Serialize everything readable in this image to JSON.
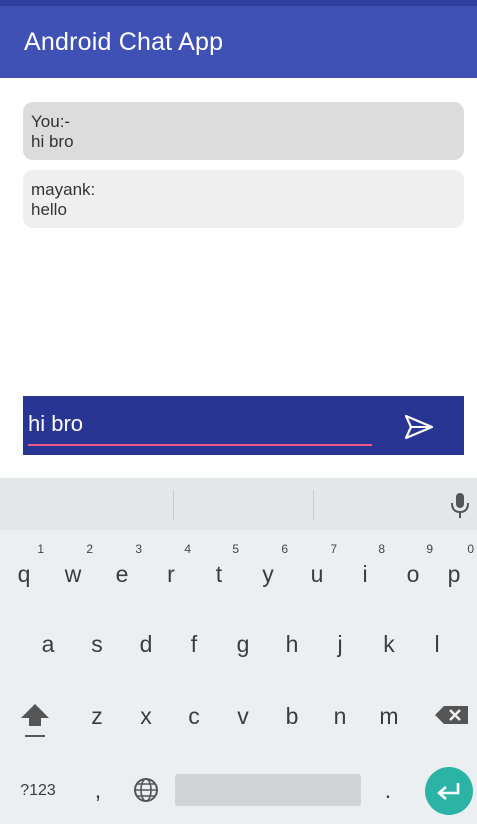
{
  "app": {
    "title": "Android Chat App"
  },
  "messages": [
    {
      "sender": "You:-",
      "text": "hi bro"
    },
    {
      "sender": "mayank:",
      "text": "hello"
    }
  ],
  "composer": {
    "value": "hi bro"
  },
  "keyboard": {
    "row1": [
      {
        "key": "q",
        "hint": "1"
      },
      {
        "key": "w",
        "hint": "2"
      },
      {
        "key": "e",
        "hint": "3"
      },
      {
        "key": "r",
        "hint": "4"
      },
      {
        "key": "t",
        "hint": "5"
      },
      {
        "key": "y",
        "hint": "6"
      },
      {
        "key": "u",
        "hint": "7"
      },
      {
        "key": "i",
        "hint": "8"
      },
      {
        "key": "o",
        "hint": "9"
      },
      {
        "key": "p",
        "hint": "0"
      }
    ],
    "row2": [
      "a",
      "s",
      "d",
      "f",
      "g",
      "h",
      "j",
      "k",
      "l"
    ],
    "row3": [
      "z",
      "x",
      "c",
      "v",
      "b",
      "n",
      "m"
    ],
    "symbols_label": "?123",
    "comma": ",",
    "period": "."
  },
  "colors": {
    "appbar": "#3f51b5",
    "composer": "#283593",
    "accent": "#e8578a",
    "enter": "#2bb3a5"
  },
  "icons": {
    "send": "send-icon",
    "mic": "mic-icon",
    "shift": "shift-icon",
    "backspace": "backspace-icon",
    "globe": "globe-icon",
    "enter": "enter-icon"
  }
}
